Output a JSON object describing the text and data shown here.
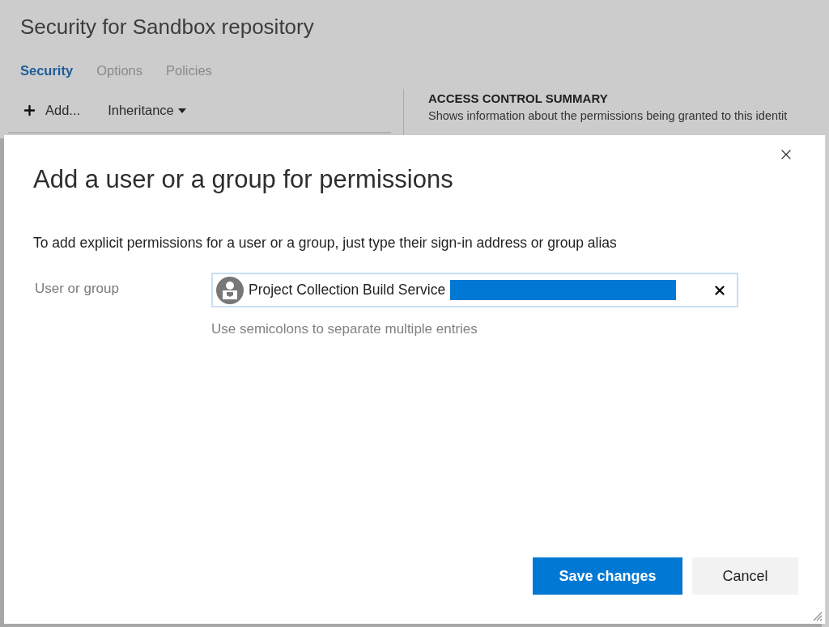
{
  "page": {
    "title": "Security for Sandbox repository",
    "tabs": [
      {
        "label": "Security",
        "selected": true
      },
      {
        "label": "Options",
        "selected": false
      },
      {
        "label": "Policies",
        "selected": false
      }
    ],
    "toolbar": {
      "add_button": "Add...",
      "inheritance_menu": "Inheritance"
    },
    "summary": {
      "heading": "ACCESS CONTROL SUMMARY",
      "description": "Shows information about the permissions being granted to this identit"
    }
  },
  "dialog": {
    "title": "Add a user or a group for permissions",
    "instructions": "To add explicit permissions for a user or a group, just type their sign-in address or group alias",
    "field": {
      "label": "User or group",
      "tokens": [
        {
          "text": "Project Collection Build Service",
          "redacted": true
        }
      ],
      "hint": "Use semicolons to separate multiple entries"
    },
    "buttons": [
      {
        "label": "Save changes",
        "kind": "primary"
      },
      {
        "label": "Cancel",
        "kind": "secondary"
      }
    ]
  }
}
